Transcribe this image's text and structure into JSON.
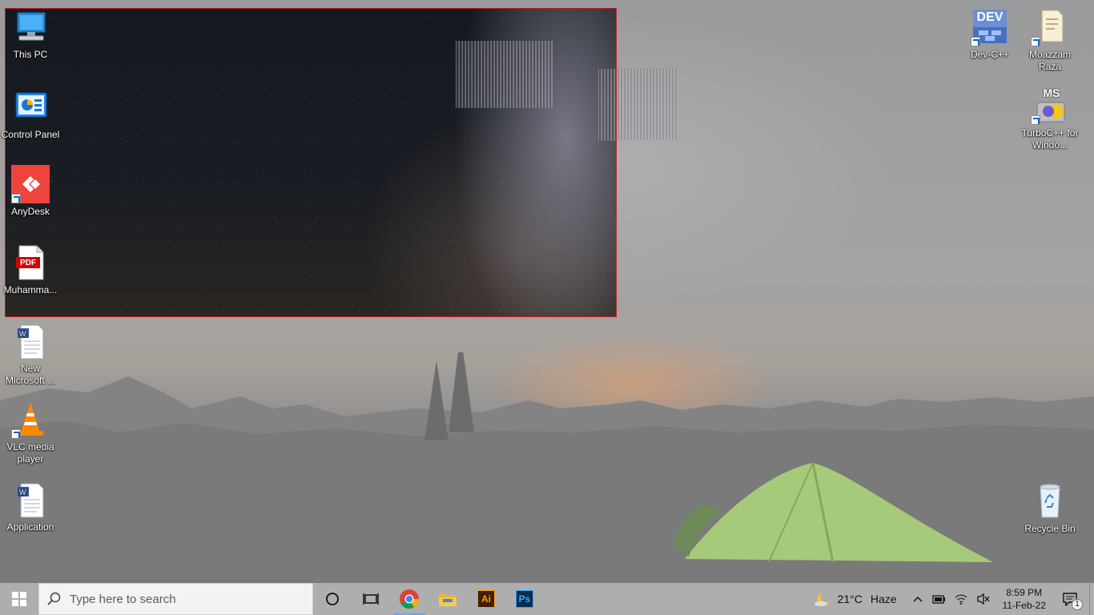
{
  "desktop": {
    "left_icons": [
      {
        "label": "This PC",
        "icon": "this-pc-icon"
      },
      {
        "label": "Control Panel",
        "icon": "control-panel-icon"
      },
      {
        "label": "AnyDesk",
        "icon": "anydesk-icon"
      },
      {
        "label": "Muhamma...",
        "icon": "pdf-file-icon",
        "badge": "PDF"
      },
      {
        "label": "New Microsoft ...",
        "icon": "word-document-icon"
      },
      {
        "label": "VLC media player",
        "icon": "vlc-icon"
      },
      {
        "label": "Application",
        "icon": "word-document-icon"
      }
    ],
    "right_icons": [
      {
        "label": "Dev-C++",
        "icon": "dev-cpp-icon",
        "badge": "DEV"
      },
      {
        "label": "Moazzam Raza",
        "icon": "folder-icon"
      },
      {
        "label": "TurboC++ for Windo...",
        "icon": "turbo-cpp-icon",
        "badge": "MS"
      },
      {
        "label": "Recycle Bin",
        "icon": "recycle-bin-icon"
      }
    ]
  },
  "taskbar": {
    "search_placeholder": "Type here to search",
    "apps": [
      {
        "name": "Google Chrome",
        "icon": "chrome-icon",
        "active": true
      },
      {
        "name": "File Explorer",
        "icon": "file-explorer-icon",
        "active": false
      },
      {
        "name": "Adobe Illustrator",
        "icon": "illustrator-icon",
        "label": "Ai",
        "active": false
      },
      {
        "name": "Adobe Photoshop",
        "icon": "photoshop-icon",
        "label": "Ps",
        "active": false
      }
    ],
    "weather": {
      "temperature": "21°C",
      "condition": "Haze",
      "icon": "moon-cloud-icon"
    },
    "clock": {
      "time": "8:59 PM",
      "date": "11-Feb-22"
    },
    "notifications": {
      "count": "1"
    }
  },
  "colors": {
    "capture_border": "#c4161c",
    "anydesk_red": "#ef443b",
    "taskbar_bg": "#aeaeae"
  }
}
